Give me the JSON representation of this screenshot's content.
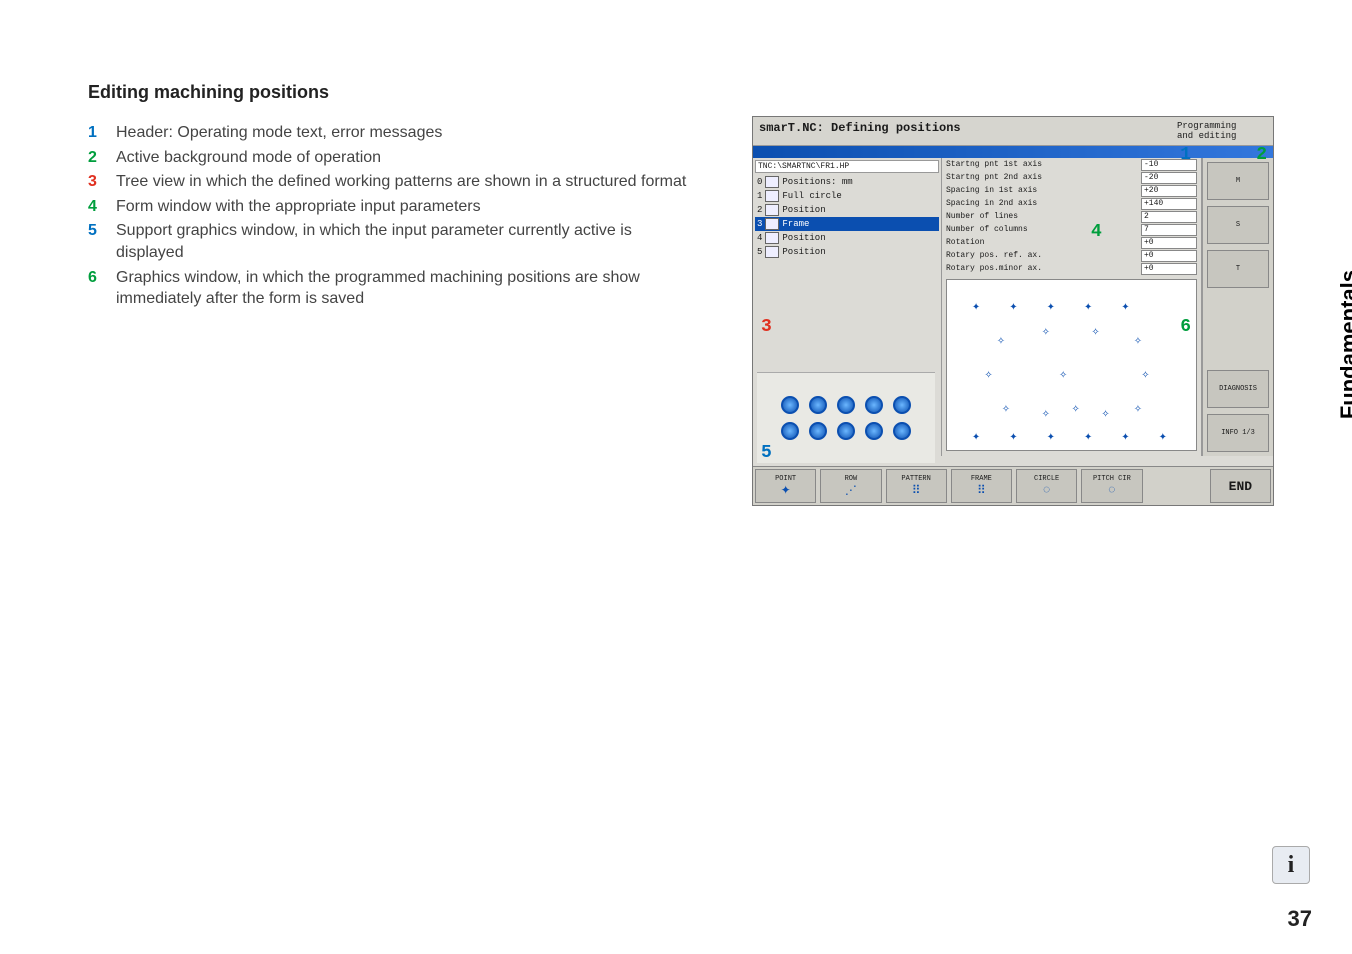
{
  "heading": "Editing machining positions",
  "list": [
    {
      "n": "1",
      "cls": "n1",
      "text": "Header: Operating mode text, error messages"
    },
    {
      "n": "2",
      "cls": "n2",
      "text": "Active background mode of operation"
    },
    {
      "n": "3",
      "cls": "n3",
      "text": "Tree view in which the defined working patterns are shown in a structured format"
    },
    {
      "n": "4",
      "cls": "n4",
      "text": "Form window with the appropriate input parameters"
    },
    {
      "n": "5",
      "cls": "n5",
      "text": "Support graphics window, in which the input parameter currently active is displayed"
    },
    {
      "n": "6",
      "cls": "n6",
      "text": "Graphics window, in which the programmed machining positions are show immediately after the form is saved"
    }
  ],
  "side_label": "Fundamentals",
  "page_number": "37",
  "shot": {
    "title": "smarT.NC: Defining positions",
    "mode": "Programming\nand editing",
    "tree_path": "TNC:\\SMARTNC\\FR1.HP",
    "tree": [
      {
        "idx": "0",
        "label": "Positions: mm",
        "sel": false
      },
      {
        "idx": "1",
        "label": "Full circle",
        "sel": false
      },
      {
        "idx": "2",
        "label": "Position",
        "sel": false
      },
      {
        "idx": "3",
        "label": "Frame",
        "sel": true
      },
      {
        "idx": "4",
        "label": "Position",
        "sel": false
      },
      {
        "idx": "5",
        "label": "Position",
        "sel": false
      }
    ],
    "form": [
      {
        "lbl": "Startng pnt 1st axis",
        "val": "-10"
      },
      {
        "lbl": "Startng pnt 2nd axis",
        "val": "-20"
      },
      {
        "lbl": "Spacing in 1st axis",
        "val": "+20"
      },
      {
        "lbl": "Spacing in 2nd axis",
        "val": "+140"
      },
      {
        "lbl": "Number of lines",
        "val": "2"
      },
      {
        "lbl": "Number of columns",
        "val": "7"
      },
      {
        "lbl": "Rotation",
        "val": "+0"
      },
      {
        "lbl": "Rotary pos. ref. ax.",
        "val": "+0"
      },
      {
        "lbl": "Rotary pos.minor ax.",
        "val": "+0"
      }
    ],
    "rail": [
      {
        "label": "M"
      },
      {
        "label": "S"
      },
      {
        "label": "T"
      },
      {
        "label": "DIAGNOSIS"
      },
      {
        "label": "INFO 1/3"
      }
    ],
    "softkeys": [
      {
        "label": "POINT"
      },
      {
        "label": "ROW"
      },
      {
        "label": "PATTERN"
      },
      {
        "label": "FRAME"
      },
      {
        "label": "CIRCLE"
      },
      {
        "label": "PITCH CIR"
      },
      {
        "label": ""
      },
      {
        "label": "END"
      }
    ],
    "callouts": {
      "1": "1",
      "2": "2",
      "3": "3",
      "4": "4",
      "5": "5",
      "6": "6"
    }
  }
}
